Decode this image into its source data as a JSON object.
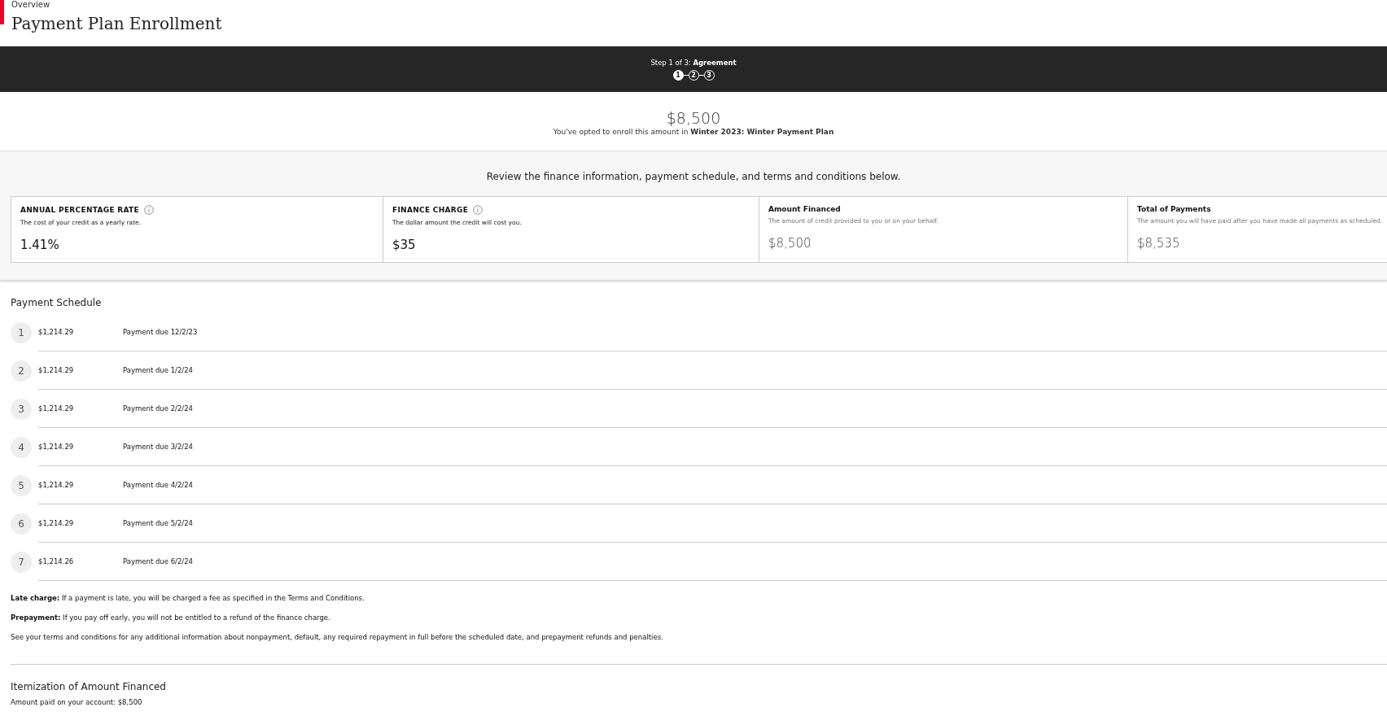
{
  "header": {
    "breadcrumb": "Overview",
    "title": "Payment Plan Enrollment"
  },
  "progress": {
    "label": "Step 1 of 3: **Agreement**",
    "steps": [
      {
        "label": "1",
        "selected": true
      },
      {
        "label": "2",
        "selected": false
      },
      {
        "label": "3",
        "selected": false
      }
    ]
  },
  "summary": {
    "amount": "$8,500",
    "text": "You've opted to enroll this amount in **Winter 2023: Winter Payment Plan**"
  },
  "finance": {
    "heading": "Review the finance information, payment schedule, and terms and conditions below.",
    "cards": [
      {
        "kind": "emphasis",
        "title": "ANNUAL PERCENTAGE RATE",
        "info": true,
        "description": "The cost of your credit as a yearly rate.",
        "value": "1.41%"
      },
      {
        "kind": "emphasis",
        "title": "FINANCE CHARGE",
        "info": true,
        "description": "The dollar amount the credit will cost you.",
        "value": "$35"
      },
      {
        "kind": "plain",
        "title": "Amount Financed",
        "info": false,
        "description": "The amount of credit provided to you or on your behalf.",
        "value": "$8,500"
      },
      {
        "kind": "plain",
        "title": "Total of Payments",
        "info": false,
        "description": "The amount you will have paid after you have made all payments as scheduled.",
        "value": "$8,535"
      }
    ]
  },
  "schedule": {
    "heading": "Payment Schedule",
    "rows": [
      {
        "number": "1",
        "amount": "$1,214.29",
        "due": "Payment due 12/2/23"
      },
      {
        "number": "2",
        "amount": "$1,214.29",
        "due": "Payment due 1/2/24"
      },
      {
        "number": "3",
        "amount": "$1,214.29",
        "due": "Payment due 2/2/24"
      },
      {
        "number": "4",
        "amount": "$1,214.29",
        "due": "Payment due 3/2/24"
      },
      {
        "number": "5",
        "amount": "$1,214.29",
        "due": "Payment due 4/2/24"
      },
      {
        "number": "6",
        "amount": "$1,214.29",
        "due": "Payment due 5/2/24"
      },
      {
        "number": "7",
        "amount": "$1,214.26",
        "due": "Payment due 6/2/24"
      }
    ]
  },
  "notes": [
    "**Late charge:** If a payment is late, you will be charged a fee as specified in the Terms and Conditions.",
    "**Prepayment:** If you pay off early, you will not be entitled to a refund of the finance charge.",
    "See your terms and conditions for any additional information about nonpayment, default, any required repayment in full before the scheduled date, and prepayment refunds and penalties."
  ],
  "itemization": {
    "heading": "Itemization of Amount Financed",
    "text": "Amount paid on your account: $8,500"
  }
}
